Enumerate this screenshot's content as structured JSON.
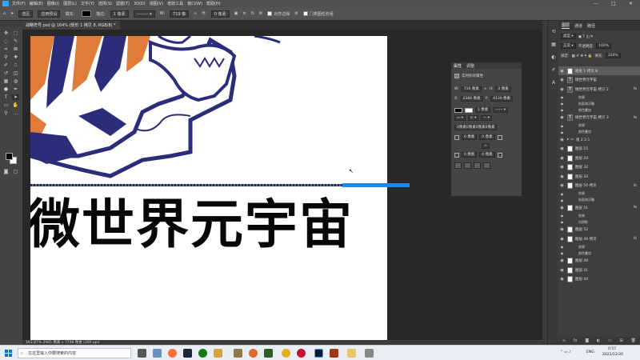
{
  "app": {
    "menu": [
      "文件(F)",
      "编辑(E)",
      "图像(I)",
      "图层(L)",
      "文字(Y)",
      "选择(S)",
      "滤镜(T)",
      "3D(D)",
      "视图(V)",
      "增效工具",
      "窗口(W)",
      "帮助(H)"
    ],
    "window_controls": [
      "—",
      "□",
      "✕"
    ]
  },
  "options_bar": {
    "fill_label": "选区",
    "preset": "应用预设",
    "fill": "填充:",
    "stroke": "描边:",
    "stroke_width": "1 像素",
    "w_label": "W:",
    "w_value": "719 像",
    "h_label": "H:",
    "h_value": "0 像素",
    "align_edges": "对齐边缘",
    "search_label": "门类图任务组"
  },
  "document": {
    "tab_title": "战略符号.psd @ 164% (矩形 1 拷贝 8, RGB/8) *",
    "headline": "微世界元宇宙",
    "status": "163.87%   2985 像素 x 7748 像素 (300 ppi)"
  },
  "properties": {
    "tabs": [
      "属性",
      "调整"
    ],
    "layer_type": "实时形状属性",
    "w_label": "W:",
    "w_value": "719 像素",
    "h_label": "H:",
    "h_value": "0 像素",
    "x_label": "X:",
    "x_value": "2386 像素",
    "y_label": "Y:",
    "y_value": "4139 像素",
    "stroke_width": "1 像素",
    "corner_link": "0像素0像素0像素0像素",
    "corners": [
      "0 像素",
      "0 像素",
      "0 像素",
      "0 像素"
    ]
  },
  "layers_panel": {
    "tabs": [
      "图层",
      "通道",
      "路径"
    ],
    "kind": "类型",
    "blend_mode": "正常",
    "opacity_label": "不透明度:",
    "opacity_value": "100%",
    "lock_label": "锁定:",
    "fill_label": "填充:",
    "fill_value": "100%",
    "rows": [
      {
        "name": "矩形 1 拷贝 8",
        "selected": true
      },
      {
        "name": "微世界元宇宙",
        "text": true
      },
      {
        "name": "微世界元宇宙 拷贝 2",
        "fx": true,
        "text": true
      },
      {
        "name": "效果",
        "sub": true
      },
      {
        "name": "斜面和浮雕",
        "sub": true
      },
      {
        "name": "颜色叠加",
        "sub": true
      },
      {
        "name": "微世界元宇宙 拷贝 3",
        "fx": true,
        "text": true
      },
      {
        "name": "效果",
        "sub": true
      },
      {
        "name": "颜色叠加",
        "sub": true
      },
      {
        "name": "组 2 2.1",
        "group": true
      },
      {
        "name": "图层 15"
      },
      {
        "name": "图层 24"
      },
      {
        "name": "图层 32"
      },
      {
        "name": "图层 33"
      },
      {
        "name": "图层 50 拷贝",
        "fx": true
      },
      {
        "name": "效果",
        "sub": true
      },
      {
        "name": "斜面和浮雕",
        "sub": true
      },
      {
        "name": "图层 51",
        "fx": true
      },
      {
        "name": "效果",
        "sub": true
      },
      {
        "name": "内阴影",
        "sub": true
      },
      {
        "name": "图层 52"
      },
      {
        "name": "图层 49 拷贝",
        "fx": true
      },
      {
        "name": "效果",
        "sub": true
      },
      {
        "name": "颜色叠加",
        "sub": true
      },
      {
        "name": "图层 48"
      },
      {
        "name": "图层 41"
      },
      {
        "name": "图层 44"
      }
    ]
  },
  "taskbar": {
    "search_placeholder": "在这里输入你要搜索的内容",
    "lang": "ENG",
    "time": "0:57",
    "date": "2021/12/30"
  },
  "colors": {
    "brand": "#31a8ff",
    "guide_blue": "#1e88e5",
    "tiger_orange": "#e07b39",
    "tiger_navy": "#2b2d7a"
  }
}
